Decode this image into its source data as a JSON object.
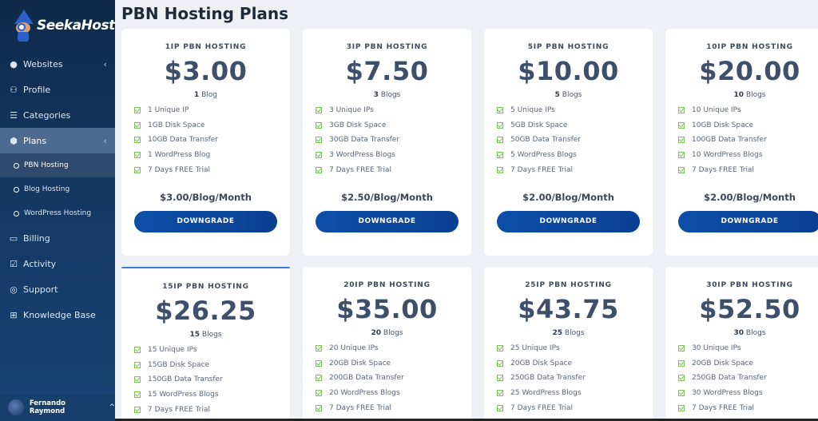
{
  "brand": {
    "name": "SeekaHost"
  },
  "sidebar": {
    "items": [
      {
        "label": "Websites",
        "icon": "globe-icon",
        "chevron": "‹"
      },
      {
        "label": "Profile",
        "icon": "user-icon"
      },
      {
        "label": "Categories",
        "icon": "database-icon"
      },
      {
        "label": "Plans",
        "icon": "box-icon",
        "chevron": "‹"
      },
      {
        "label": "Billing",
        "icon": "credit-card-icon"
      },
      {
        "label": "Activity",
        "icon": "checklist-icon"
      },
      {
        "label": "Support",
        "icon": "lifebuoy-icon"
      },
      {
        "label": "Knowledge Base",
        "icon": "book-icon"
      }
    ],
    "subitems": [
      {
        "label": "PBN Hosting"
      },
      {
        "label": "Blog Hosting"
      },
      {
        "label": "WordPress Hosting"
      }
    ]
  },
  "user": {
    "name": "Fernando Raymond",
    "caret": "^"
  },
  "page": {
    "title": "PBN Hosting Plans"
  },
  "plans": [
    {
      "name": "1IP PBN HOSTING",
      "price": "$3.00",
      "blog_count": "1",
      "blog_label": "Blog",
      "features": [
        "1 Unique IP",
        "1GB Disk Space",
        "10GB Data Transfer",
        "1 WordPress Blog",
        "7 Days FREE Trial"
      ],
      "per": "$3.00/Blog/Month",
      "button": "DOWNGRADE"
    },
    {
      "name": "3IP PBN HOSTING",
      "price": "$7.50",
      "blog_count": "3",
      "blog_label": "Blogs",
      "features": [
        "3 Unique IPs",
        "3GB Disk Space",
        "30GB Data Transfer",
        "3 WordPress Blogs",
        "7 Days FREE Trial"
      ],
      "per": "$2.50/Blog/Month",
      "button": "DOWNGRADE"
    },
    {
      "name": "5IP PBN HOSTING",
      "price": "$10.00",
      "blog_count": "5",
      "blog_label": "Blogs",
      "features": [
        "5 Unique IPs",
        "5GB Disk Space",
        "50GB Data Transfer",
        "5 WordPress Blogs",
        "7 Days FREE Trial"
      ],
      "per": "$2.00/Blog/Month",
      "button": "DOWNGRADE"
    },
    {
      "name": "10IP PBN HOSTING",
      "price": "$20.00",
      "blog_count": "10",
      "blog_label": "Blogs",
      "features": [
        "10 Unique IPs",
        "10GB Disk Space",
        "100GB Data Transfer",
        "10 WordPress Blogs",
        "7 Days FREE Trial"
      ],
      "per": "$2.00/Blog/Month",
      "button": "DOWNGRADE"
    },
    {
      "name": "15IP PBN HOSTING",
      "price": "$26.25",
      "blog_count": "15",
      "blog_label": "Blogs",
      "features": [
        "15 Unique IPs",
        "15GB Disk Space",
        "150GB Data Transfer",
        "15 WordPress Blogs",
        "7 Days FREE Trial"
      ]
    },
    {
      "name": "20IP PBN HOSTING",
      "price": "$35.00",
      "blog_count": "20",
      "blog_label": "Blogs",
      "features": [
        "20 Unique IPs",
        "20GB Disk Space",
        "200GB Data Transfer",
        "20 WordPress Blogs",
        "7 Days FREE Trial"
      ]
    },
    {
      "name": "25IP PBN HOSTING",
      "price": "$43.75",
      "blog_count": "25",
      "blog_label": "Blogs",
      "features": [
        "25 Unique IPs",
        "20GB Disk Space",
        "250GB Data Transfer",
        "25 WordPress Blogs",
        "7 Days FREE Trial"
      ]
    },
    {
      "name": "30IP PBN HOSTING",
      "price": "$52.50",
      "blog_count": "30",
      "blog_label": "Blogs",
      "features": [
        "30 Unique IPs",
        "20GB Disk Space",
        "250GB Data Transfer",
        "30 WordPress Blogs",
        "7 Days FREE Trial"
      ]
    }
  ]
}
